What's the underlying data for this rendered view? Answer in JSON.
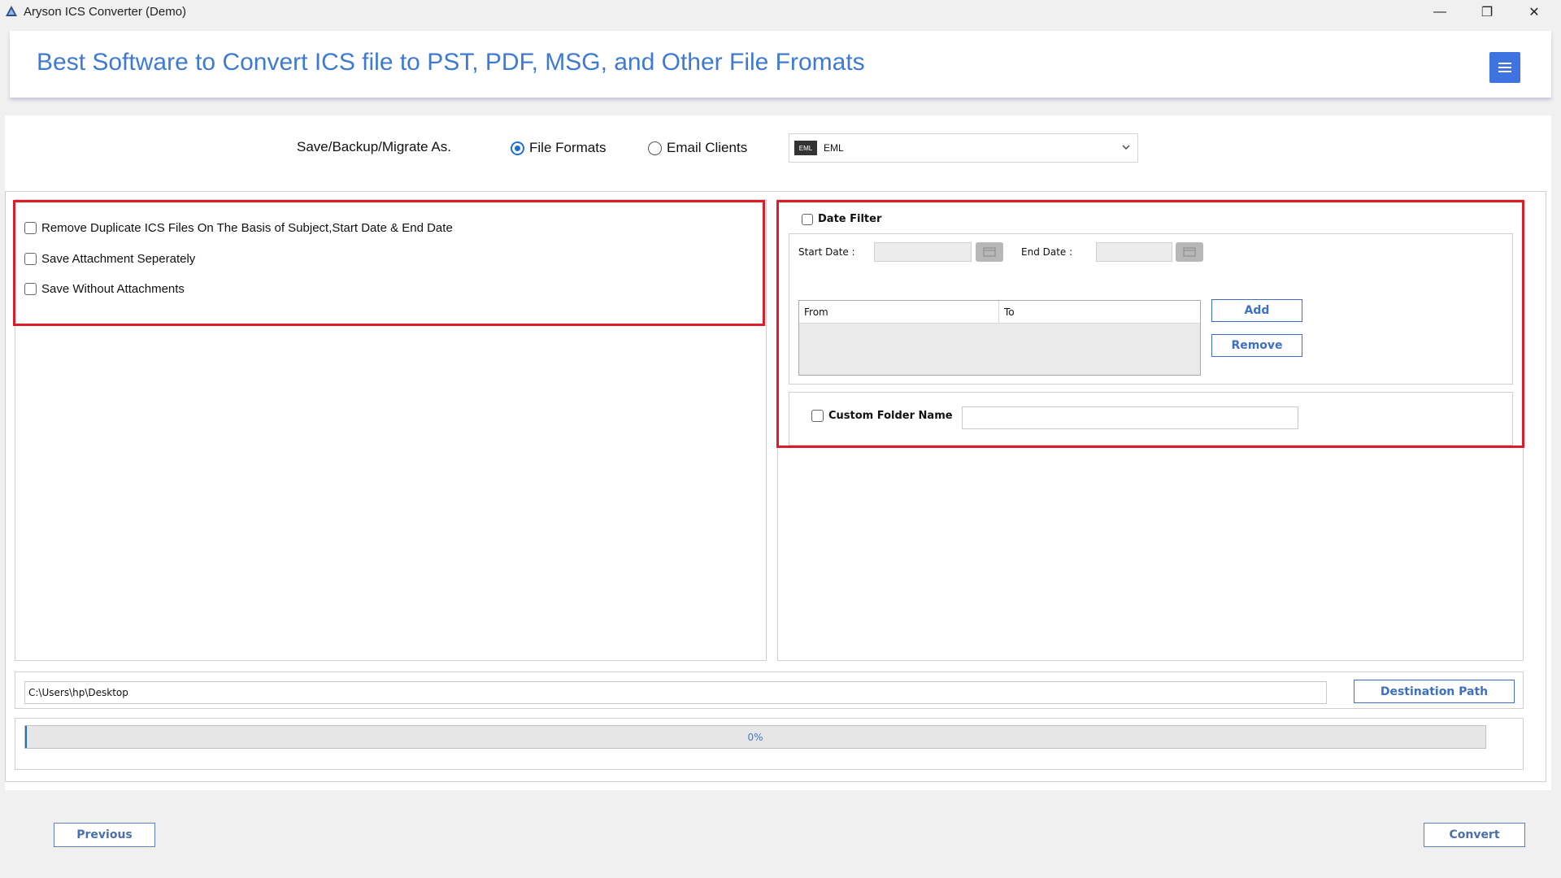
{
  "window": {
    "title": "Aryson ICS Converter (Demo)",
    "min_glyph": "—",
    "max_glyph": "❐",
    "close_glyph": "✕"
  },
  "banner": {
    "headline": "Best Software to Convert ICS file to PST, PDF, MSG, and Other File Fromats",
    "menu_icon": "hamburger-menu-icon"
  },
  "save_as": {
    "label": "Save/Backup/Migrate As.",
    "options": [
      {
        "label": "File Formats",
        "checked": true
      },
      {
        "label": "Email Clients",
        "checked": false
      }
    ],
    "format": {
      "icon_text": "EML",
      "selected": "EML"
    }
  },
  "options": {
    "items": [
      {
        "label": "Remove Duplicate ICS Files On The Basis of Subject,Start Date & End Date",
        "checked": false
      },
      {
        "label": "Save Attachment Seperately",
        "checked": false
      },
      {
        "label": "Save Without Attachments",
        "checked": false
      }
    ]
  },
  "date_filter": {
    "label": "Date Filter",
    "checked": false,
    "start_label": "Start Date :",
    "end_label": "End Date :",
    "start_value": "",
    "end_value": "",
    "columns": [
      "From",
      "To"
    ],
    "add_label": "Add",
    "remove_label": "Remove"
  },
  "custom_folder": {
    "label": "Custom Folder Name",
    "checked": false,
    "value": ""
  },
  "destination": {
    "path": "C:\\Users\\hp\\Desktop",
    "button_label": "Destination Path"
  },
  "progress": {
    "percent": 0,
    "text": "0%"
  },
  "footer": {
    "previous_label": "Previous",
    "convert_label": "Convert"
  },
  "colors": {
    "accent": "#3f7ad1",
    "highlight_border": "#dd1c2a",
    "menu_button": "#3f74e0"
  }
}
